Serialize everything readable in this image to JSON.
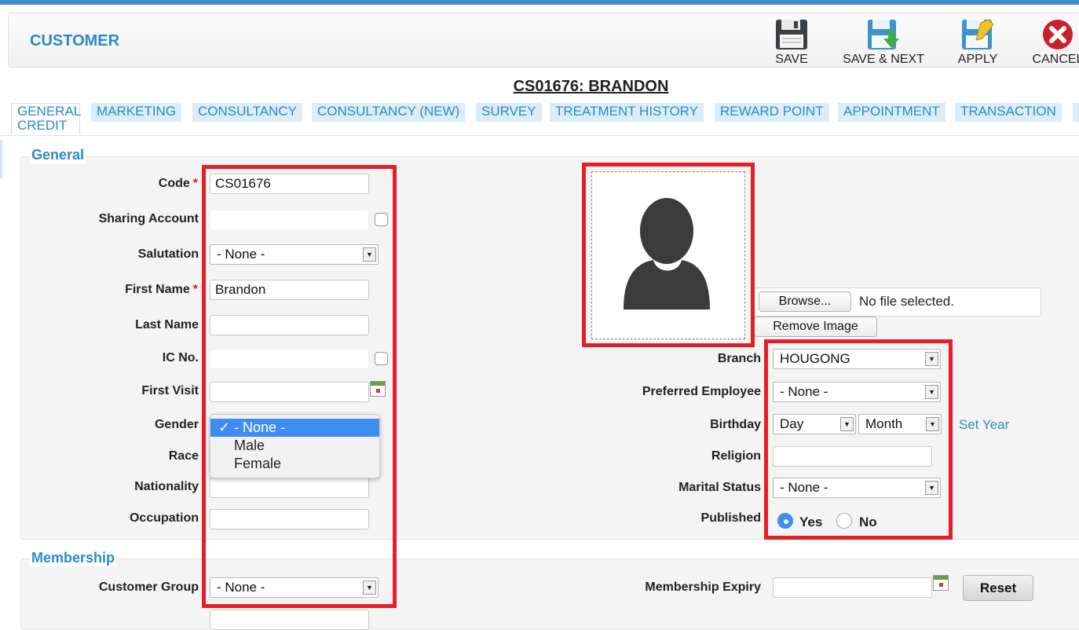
{
  "header": {
    "title": "CUSTOMER",
    "toolbar": {
      "save": "SAVE",
      "save_next": "SAVE & NEXT",
      "apply": "APPLY",
      "cancel": "CANCEL"
    }
  },
  "record_title": "CS01676: BRANDON",
  "tabs": [
    {
      "label": "GENERAL CREDIT",
      "label_line1": "GENERAL",
      "label_line2": "CREDIT",
      "active": true
    },
    {
      "label": "MARKETING"
    },
    {
      "label": "CONSULTANCY"
    },
    {
      "label": "CONSULTANCY (NEW)"
    },
    {
      "label": "SURVEY"
    },
    {
      "label": "TREATMENT HISTORY"
    },
    {
      "label": "REWARD POINT"
    },
    {
      "label": "APPOINTMENT"
    },
    {
      "label": "TRANSACTION"
    }
  ],
  "general": {
    "legend": "General",
    "code": {
      "label": "Code",
      "value": "CS01676"
    },
    "sharing_account": {
      "label": "Sharing Account",
      "value": ""
    },
    "salutation": {
      "label": "Salutation",
      "value": "- None -"
    },
    "first_name": {
      "label": "First Name",
      "value": "Brandon"
    },
    "last_name": {
      "label": "Last Name",
      "value": ""
    },
    "ic_no": {
      "label": "IC No.",
      "value": ""
    },
    "first_visit": {
      "label": "First Visit",
      "value": ""
    },
    "gender": {
      "label": "Gender",
      "options": [
        "- None -",
        "Male",
        "Female"
      ],
      "selected": "- None -",
      "check": "✓"
    },
    "race": {
      "label": "Race"
    },
    "nationality": {
      "label": "Nationality"
    },
    "occupation": {
      "label": "Occupation",
      "value": ""
    },
    "photo": {
      "browse_label": "Browse...",
      "file_status": "No file selected.",
      "remove_label": "Remove Image"
    },
    "branch": {
      "label": "Branch",
      "value": "HOUGONG"
    },
    "preferred_employee": {
      "label": "Preferred Employee",
      "value": "- None -"
    },
    "birthday": {
      "label": "Birthday",
      "day": "Day",
      "month": "Month",
      "set_year": "Set Year"
    },
    "religion": {
      "label": "Religion",
      "value": ""
    },
    "marital_status": {
      "label": "Marital Status",
      "value": "- None -"
    },
    "published": {
      "label": "Published",
      "yes": "Yes",
      "no": "No",
      "selected": "Yes"
    }
  },
  "membership": {
    "legend": "Membership",
    "customer_group": {
      "label": "Customer Group",
      "value": "- None -"
    },
    "membership_expiry": {
      "label": "Membership Expiry",
      "value": ""
    },
    "reset_label": "Reset"
  },
  "colors": {
    "accent": "#2b8ac6",
    "highlight": "#e3202a",
    "selected_option": "#3d8ef0"
  }
}
